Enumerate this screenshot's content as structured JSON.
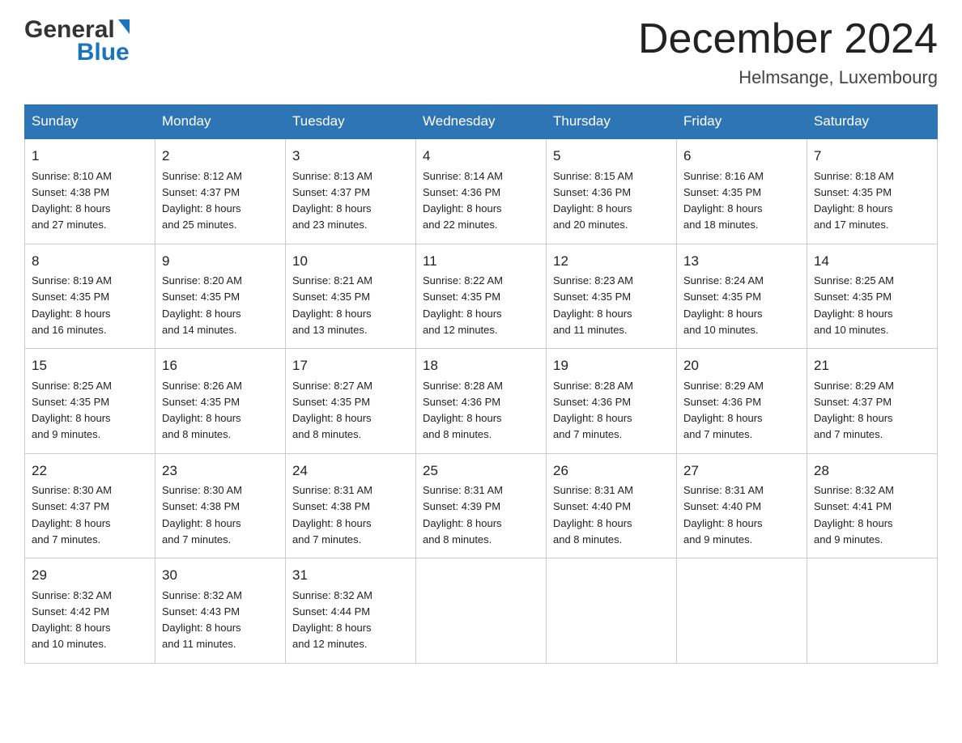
{
  "header": {
    "logo_general": "General",
    "logo_blue": "Blue",
    "month_title": "December 2024",
    "subtitle": "Helmsange, Luxembourg"
  },
  "calendar": {
    "days_of_week": [
      "Sunday",
      "Monday",
      "Tuesday",
      "Wednesday",
      "Thursday",
      "Friday",
      "Saturday"
    ],
    "weeks": [
      [
        {
          "day": "1",
          "sunrise": "8:10 AM",
          "sunset": "4:38 PM",
          "daylight": "8 hours and 27 minutes."
        },
        {
          "day": "2",
          "sunrise": "8:12 AM",
          "sunset": "4:37 PM",
          "daylight": "8 hours and 25 minutes."
        },
        {
          "day": "3",
          "sunrise": "8:13 AM",
          "sunset": "4:37 PM",
          "daylight": "8 hours and 23 minutes."
        },
        {
          "day": "4",
          "sunrise": "8:14 AM",
          "sunset": "4:36 PM",
          "daylight": "8 hours and 22 minutes."
        },
        {
          "day": "5",
          "sunrise": "8:15 AM",
          "sunset": "4:36 PM",
          "daylight": "8 hours and 20 minutes."
        },
        {
          "day": "6",
          "sunrise": "8:16 AM",
          "sunset": "4:35 PM",
          "daylight": "8 hours and 18 minutes."
        },
        {
          "day": "7",
          "sunrise": "8:18 AM",
          "sunset": "4:35 PM",
          "daylight": "8 hours and 17 minutes."
        }
      ],
      [
        {
          "day": "8",
          "sunrise": "8:19 AM",
          "sunset": "4:35 PM",
          "daylight": "8 hours and 16 minutes."
        },
        {
          "day": "9",
          "sunrise": "8:20 AM",
          "sunset": "4:35 PM",
          "daylight": "8 hours and 14 minutes."
        },
        {
          "day": "10",
          "sunrise": "8:21 AM",
          "sunset": "4:35 PM",
          "daylight": "8 hours and 13 minutes."
        },
        {
          "day": "11",
          "sunrise": "8:22 AM",
          "sunset": "4:35 PM",
          "daylight": "8 hours and 12 minutes."
        },
        {
          "day": "12",
          "sunrise": "8:23 AM",
          "sunset": "4:35 PM",
          "daylight": "8 hours and 11 minutes."
        },
        {
          "day": "13",
          "sunrise": "8:24 AM",
          "sunset": "4:35 PM",
          "daylight": "8 hours and 10 minutes."
        },
        {
          "day": "14",
          "sunrise": "8:25 AM",
          "sunset": "4:35 PM",
          "daylight": "8 hours and 10 minutes."
        }
      ],
      [
        {
          "day": "15",
          "sunrise": "8:25 AM",
          "sunset": "4:35 PM",
          "daylight": "8 hours and 9 minutes."
        },
        {
          "day": "16",
          "sunrise": "8:26 AM",
          "sunset": "4:35 PM",
          "daylight": "8 hours and 8 minutes."
        },
        {
          "day": "17",
          "sunrise": "8:27 AM",
          "sunset": "4:35 PM",
          "daylight": "8 hours and 8 minutes."
        },
        {
          "day": "18",
          "sunrise": "8:28 AM",
          "sunset": "4:36 PM",
          "daylight": "8 hours and 8 minutes."
        },
        {
          "day": "19",
          "sunrise": "8:28 AM",
          "sunset": "4:36 PM",
          "daylight": "8 hours and 7 minutes."
        },
        {
          "day": "20",
          "sunrise": "8:29 AM",
          "sunset": "4:36 PM",
          "daylight": "8 hours and 7 minutes."
        },
        {
          "day": "21",
          "sunrise": "8:29 AM",
          "sunset": "4:37 PM",
          "daylight": "8 hours and 7 minutes."
        }
      ],
      [
        {
          "day": "22",
          "sunrise": "8:30 AM",
          "sunset": "4:37 PM",
          "daylight": "8 hours and 7 minutes."
        },
        {
          "day": "23",
          "sunrise": "8:30 AM",
          "sunset": "4:38 PM",
          "daylight": "8 hours and 7 minutes."
        },
        {
          "day": "24",
          "sunrise": "8:31 AM",
          "sunset": "4:38 PM",
          "daylight": "8 hours and 7 minutes."
        },
        {
          "day": "25",
          "sunrise": "8:31 AM",
          "sunset": "4:39 PM",
          "daylight": "8 hours and 8 minutes."
        },
        {
          "day": "26",
          "sunrise": "8:31 AM",
          "sunset": "4:40 PM",
          "daylight": "8 hours and 8 minutes."
        },
        {
          "day": "27",
          "sunrise": "8:31 AM",
          "sunset": "4:40 PM",
          "daylight": "8 hours and 9 minutes."
        },
        {
          "day": "28",
          "sunrise": "8:32 AM",
          "sunset": "4:41 PM",
          "daylight": "8 hours and 9 minutes."
        }
      ],
      [
        {
          "day": "29",
          "sunrise": "8:32 AM",
          "sunset": "4:42 PM",
          "daylight": "8 hours and 10 minutes."
        },
        {
          "day": "30",
          "sunrise": "8:32 AM",
          "sunset": "4:43 PM",
          "daylight": "8 hours and 11 minutes."
        },
        {
          "day": "31",
          "sunrise": "8:32 AM",
          "sunset": "4:44 PM",
          "daylight": "8 hours and 12 minutes."
        },
        null,
        null,
        null,
        null
      ]
    ],
    "sunrise_label": "Sunrise:",
    "sunset_label": "Sunset:",
    "daylight_label": "Daylight:"
  }
}
